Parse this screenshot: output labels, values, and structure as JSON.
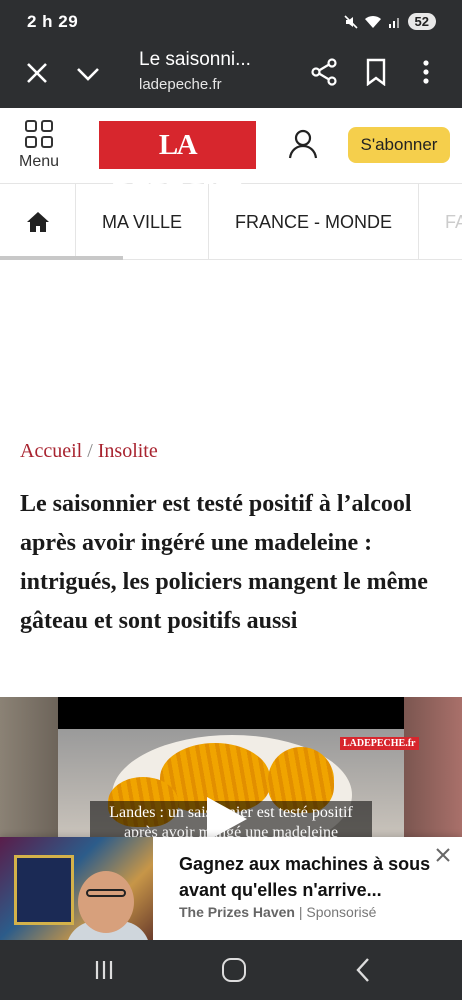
{
  "status_bar": {
    "time": "2 h 29",
    "battery": "52"
  },
  "browser": {
    "page_title": "Le saisonni...",
    "url": "ladepeche.fr"
  },
  "site_header": {
    "menu_label": "Menu",
    "logo_text": "LA DÉPÊCHE",
    "subscribe_label": "S'abonner"
  },
  "nav": {
    "items": [
      "MA VILLE",
      "FRANCE - MONDE",
      "FA"
    ]
  },
  "breadcrumb": {
    "home": "Accueil",
    "separator": "/",
    "section": "Insolite"
  },
  "article": {
    "headline": "Le saisonnier est testé positif à l’alcool après avoir ingéré une madeleine : intrigués, les policiers mangent le même gâteau et sont positifs aussi"
  },
  "video": {
    "logo": "LADEPECHE.fr",
    "caption": "Landes : un saisonnier est testé positif après avoir mangé une madeleine"
  },
  "ad": {
    "title": "Gagnez aux machines à sous avant qu'elles n'arrive...",
    "advertiser": "The Prizes Haven",
    "separator": "|",
    "sponsored": "Sponsorisé"
  },
  "colors": {
    "brand_red": "#d7262d",
    "subscribe_yellow": "#f5cf4c",
    "breadcrumb_red": "#a8232f",
    "system_bar": "#2d2f31"
  }
}
